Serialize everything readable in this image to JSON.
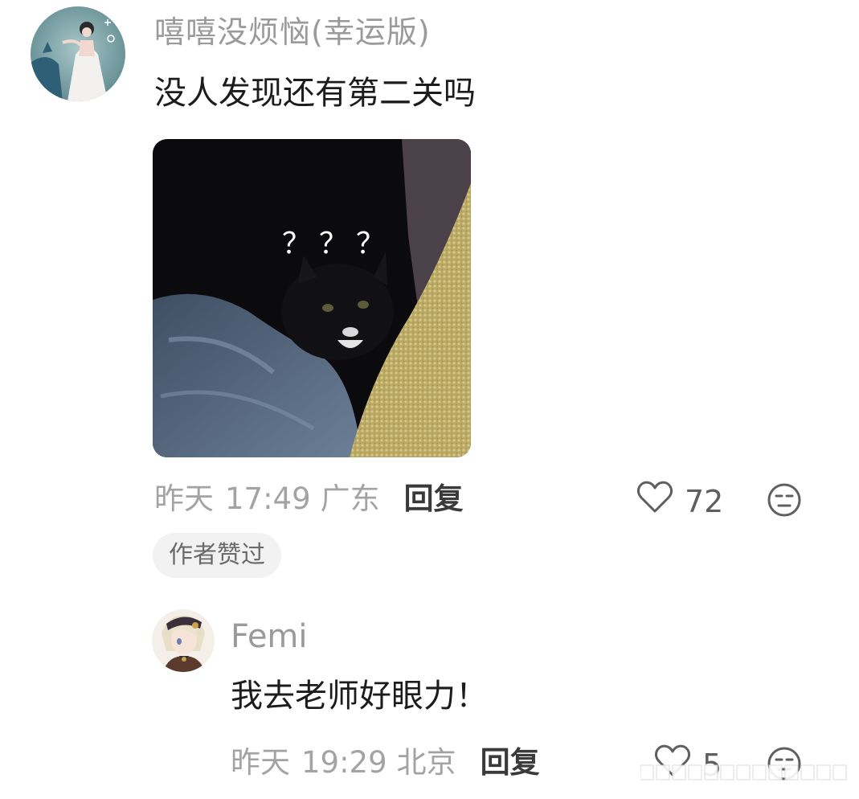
{
  "main_comment": {
    "username": "嘻嘻没烦恼(幸运版)",
    "text": "没人发现还有第二关吗",
    "image_overlay_text": "？？？",
    "date": "昨天",
    "time": "17:49",
    "location": "广东",
    "reply_label": "回复",
    "like_count": "72",
    "badge": "作者赞过"
  },
  "reply_comment": {
    "username": "Femi",
    "text": "我去老师好眼力！",
    "date": "昨天",
    "time": "19:29",
    "location": "北京",
    "reply_label": "回复",
    "like_count": "5"
  },
  "icons": {
    "like": "heart-outline-icon",
    "emoji": "neutral-face-icon"
  },
  "colors": {
    "meta_text": "#a3a3a3",
    "username": "#9a9a9a",
    "body_text": "#1c1c1c",
    "badge_bg": "#f2f2f2"
  }
}
